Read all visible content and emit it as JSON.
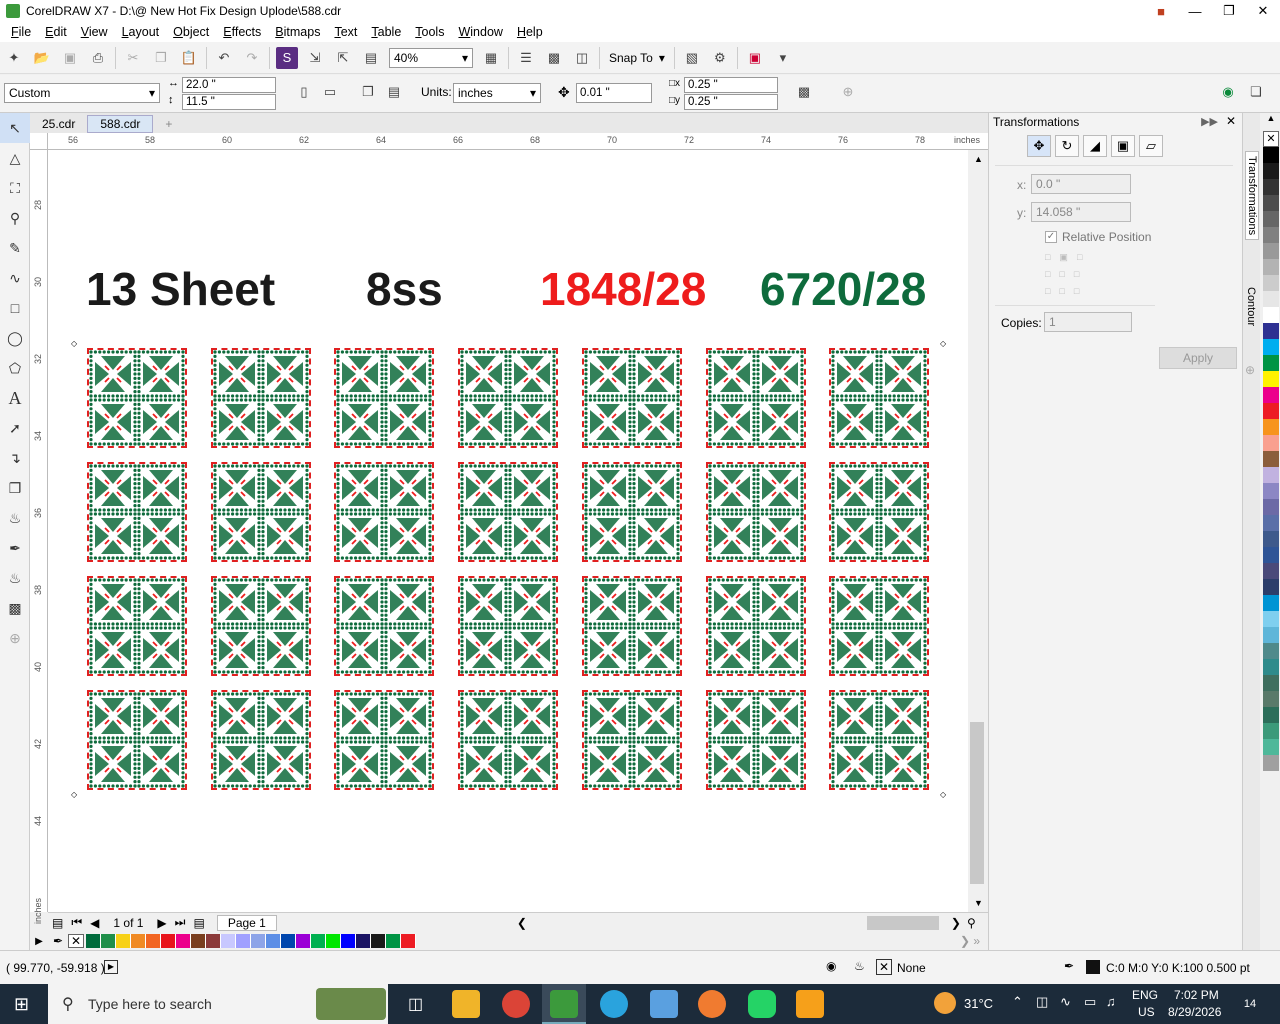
{
  "window": {
    "title": "CorelDRAW X7 - D:\\@ New Hot Fix Design Uplode\\588.cdr"
  },
  "menu": [
    "File",
    "Edit",
    "View",
    "Layout",
    "Object",
    "Effects",
    "Bitmaps",
    "Text",
    "Table",
    "Tools",
    "Window",
    "Help"
  ],
  "toolbar": {
    "zoom": "40%",
    "snap_to": "Snap To"
  },
  "propbar": {
    "page_preset": "Custom",
    "width": "22.0 \"",
    "height": "11.5 \"",
    "units_label": "Units:",
    "units": "inches",
    "nudge": "0.01 \"",
    "dup_x": "0.25 \"",
    "dup_y": "0.25 \""
  },
  "doc_tabs": [
    "25.cdr",
    "588.cdr"
  ],
  "rulers": {
    "h_ticks": [
      "56",
      "58",
      "60",
      "62",
      "64",
      "66",
      "68",
      "70",
      "72",
      "74",
      "76",
      "78"
    ],
    "h_unit": "inches",
    "v_ticks": [
      "28",
      "30",
      "32",
      "34",
      "36",
      "38",
      "40",
      "42",
      "44"
    ],
    "v_unit": "inches"
  },
  "canvas": {
    "label_sheet": "13 Sheet",
    "label_ss": "8ss",
    "label_red": "1848/28",
    "label_green": "6720/28",
    "colors": {
      "red": "#ee1c1c",
      "green": "#0e6b3c",
      "dark": "#1a1a1a"
    }
  },
  "pagenav": {
    "page_count": "1 of 1",
    "page_tab": "Page 1"
  },
  "docker": {
    "title": "Transformations",
    "x_label": "x:",
    "x_value": "0.0 \"",
    "y_label": "y:",
    "y_value": "14.058 \"",
    "relative_position": "Relative Position",
    "copies_label": "Copies:",
    "copies_value": "1",
    "apply": "Apply",
    "side_tabs": [
      "Transformations",
      "Contour"
    ]
  },
  "palette_colors": [
    "#006b3c",
    "#1f8f4a",
    "#f7d117",
    "#f08a24",
    "#f26522",
    "#e8141b",
    "#ec008c",
    "#7a3f1f",
    "#8b3a3a",
    "#c8c8ff",
    "#a0a0ff",
    "#8da4e8",
    "#5c8ee6",
    "#0046ad",
    "#9b00d6",
    "#00b050",
    "#00e600",
    "#0000ff",
    "#1b1464",
    "#1a1a1a",
    "#009444",
    "#ed1c24"
  ],
  "right_palette": [
    "#000000",
    "#1a1a1a",
    "#333333",
    "#4d4d4d",
    "#666666",
    "#808080",
    "#999999",
    "#b3b3b3",
    "#cccccc",
    "#e6e6e6",
    "#ffffff",
    "#2e3192",
    "#00aeef",
    "#009444",
    "#fff200",
    "#ec008c",
    "#ed1c24",
    "#f7941d",
    "#f9a08f",
    "#8b5e3c",
    "#c1b2e0",
    "#8c87c4",
    "#6c6aa6",
    "#5a6fa8",
    "#3e5a8c",
    "#2f5597",
    "#4a4a7a",
    "#2c3e6b",
    "#0094d4",
    "#7fcfef",
    "#5fb6d9",
    "#4f8a8b",
    "#2e8b8b",
    "#3f6f5f",
    "#5a7a6a",
    "#2c6e5a",
    "#3c9a7a",
    "#4fb89a",
    "#a0a0a0"
  ],
  "status": {
    "coords": "( 99.770, -59.918 )",
    "fill_none": "None",
    "outline": "C:0 M:0 Y:0 K:100  0.500 pt"
  },
  "taskbar": {
    "search_placeholder": "Type here to search",
    "weather": "31°C",
    "lang1": "ENG",
    "lang2": "US",
    "time": "7:02 PM",
    "date": "8/29/2026",
    "notif_count": "14"
  }
}
